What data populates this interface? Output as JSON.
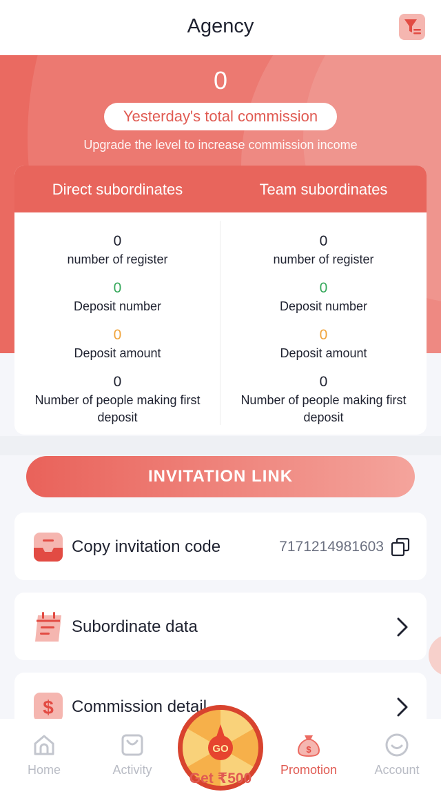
{
  "header": {
    "title": "Agency",
    "filter_icon": "filter-icon"
  },
  "hero": {
    "yesterday_value": "0",
    "yesterday_label": "Yesterday's total commission",
    "upgrade_note": "Upgrade the level to increase commission income"
  },
  "stats": {
    "direct": {
      "title": "Direct subordinates",
      "register_value": "0",
      "register_label": "number of register",
      "deposit_num_value": "0",
      "deposit_num_label": "Deposit number",
      "deposit_amt_value": "0",
      "deposit_amt_label": "Deposit amount",
      "first_dep_value": "0",
      "first_dep_label": "Number of people making first deposit"
    },
    "team": {
      "title": "Team subordinates",
      "register_value": "0",
      "register_label": "number of register",
      "deposit_num_value": "0",
      "deposit_num_label": "Deposit number",
      "deposit_amt_value": "0",
      "deposit_amt_label": "Deposit amount",
      "first_dep_value": "0",
      "first_dep_label": "Number of people making first deposit"
    }
  },
  "invitation_link_label": "INVITATION LINK",
  "rows": {
    "copy_code": {
      "label": "Copy invitation code",
      "value": "7171214981603",
      "icon": "inbox-icon"
    },
    "subordinate": {
      "label": "Subordinate data",
      "icon": "calendar-icon"
    },
    "commission": {
      "label": "Commission detail",
      "icon": "dollar-icon"
    }
  },
  "tabbar": {
    "home": "Home",
    "activity": "Activity",
    "center": "Get ₹500",
    "center_badge": "GO",
    "promotion": "Promotion",
    "account": "Account"
  },
  "colors": {
    "brand": "#e8655c",
    "positive": "#36a85b",
    "amount": "#f0a43c",
    "text": "#1f2230",
    "tab_inactive": "#b9bcc5"
  }
}
